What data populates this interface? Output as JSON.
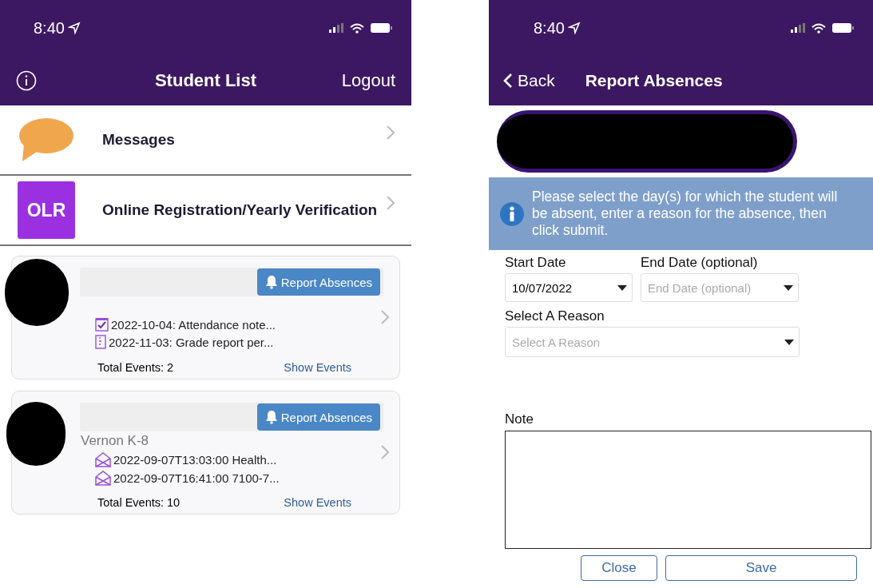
{
  "student_list_screen": {
    "status_bar": {
      "time": "8:40"
    },
    "nav_bar": {
      "title": "Student List",
      "right_button": "Logout"
    },
    "menu_items": [
      {
        "kind": "chat",
        "label": "Messages"
      },
      {
        "kind": "badge",
        "badge": "OLR",
        "label": "Online Registration/Yearly Verification"
      }
    ],
    "students": [
      {
        "button": "Report Absences",
        "events": [
          {
            "kind": "attendance",
            "text": "2022-10-04: Attendance note..."
          },
          {
            "kind": "grade",
            "text": "2022-11-03: Grade report per..."
          }
        ],
        "total": "Total Events: 2",
        "link": "Show Events"
      },
      {
        "school": "Vernon K-8",
        "button": "Report Absences",
        "events": [
          {
            "kind": "mail",
            "text": "2022-09-07T13:03:00 Health..."
          },
          {
            "kind": "mail",
            "text": "2022-09-07T16:41:00 7100-7..."
          }
        ],
        "total": "Total Events: 10",
        "link": "Show Events"
      }
    ]
  },
  "report_absences_screen": {
    "status_bar": {
      "time": "8:40"
    },
    "nav_bar": {
      "back": "Back",
      "title": "Report Absences"
    },
    "info": "Please select the day(s) for which the student will be absent, enter a reason for the absence, then click submit.",
    "start_date": {
      "label": "Start Date",
      "value": "10/07/2022"
    },
    "end_date": {
      "label": "End Date (optional)",
      "placeholder": "End Date (optional)"
    },
    "reason": {
      "label": "Select A Reason",
      "placeholder": "Select A Reason"
    },
    "note": {
      "label": "Note"
    },
    "buttons": [
      "Close",
      "Save"
    ]
  }
}
